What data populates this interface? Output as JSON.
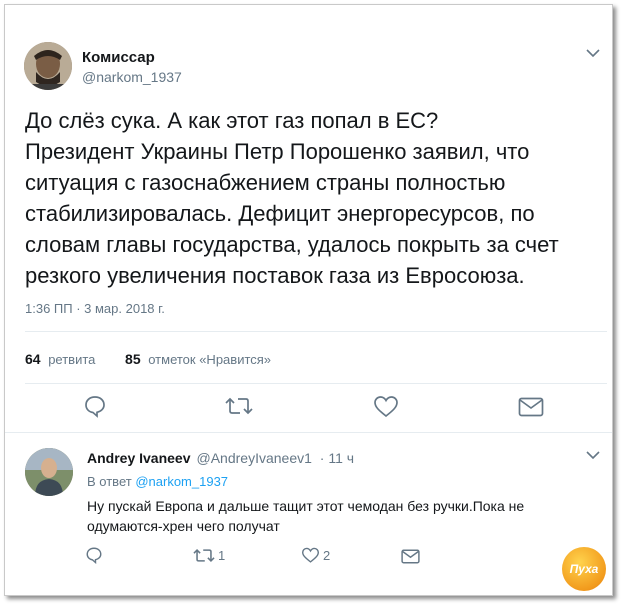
{
  "tweet": {
    "author_name": "Комиссар",
    "author_handle": "@narkom_1937",
    "text_lines": [
      "До слёз сука. А как этот газ попал в ЕС?",
      "Президент Украины Петр Порошенко заявил, что",
      "ситуация с газоснабжением страны полностью",
      "стабилизировалась. Дефицит энергоресурсов, по",
      "словам главы государства, удалось покрыть за счет",
      "резкого увеличения поставок газа из Евросоюза."
    ],
    "timestamp": "1:36 ПП · 3 мар. 2018 г.",
    "retweets_count": "64",
    "retweets_label": "ретвита",
    "likes_count": "85",
    "likes_label": "отметок «Нравится»"
  },
  "reply": {
    "author_name": "Andrey Ivaneev",
    "author_handle": "@AndreyIvaneev1",
    "time": "· 11 ч",
    "reply_to_prefix": "В ответ",
    "reply_to_handle": "@narkom_1937",
    "text_lines": [
      "Ну пускай Европа и дальше тащит этот чемодан без ручки.Пока не",
      "одумаются-хрен чего получат"
    ],
    "retweet_count": "1",
    "like_count": "2"
  },
  "watermark": {
    "text": "Пуха"
  },
  "colors": {
    "muted": "#657786",
    "link": "#1da1f2",
    "text": "#14171a",
    "border": "#e6ecf0"
  }
}
